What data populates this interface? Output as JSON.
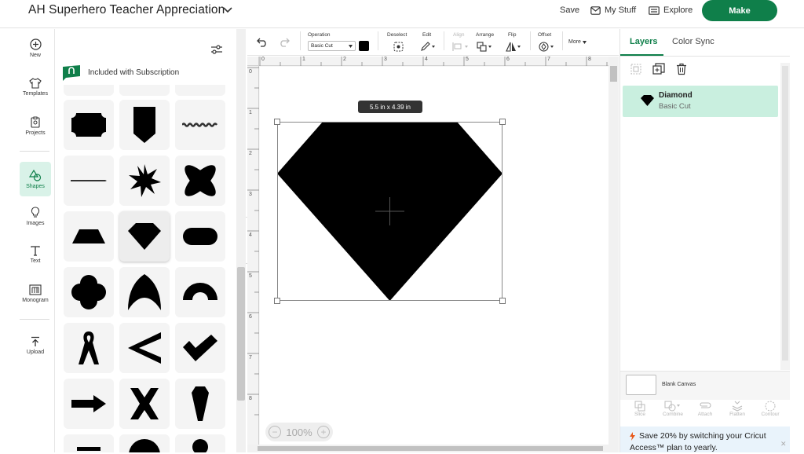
{
  "header": {
    "project_title": "AH Superhero Teacher Appreciation",
    "save_label": "Save",
    "my_stuff_label": "My Stuff",
    "explore_label": "Explore",
    "make_label": "Make"
  },
  "left_nav": {
    "items": [
      {
        "label": "New",
        "icon": "plus-circle-icon"
      },
      {
        "label": "Templates",
        "icon": "shirt-icon"
      },
      {
        "label": "Projects",
        "icon": "projects-icon"
      },
      {
        "label": "Shapes",
        "icon": "shapes-icon",
        "active": true
      },
      {
        "label": "Images",
        "icon": "lightbulb-icon"
      },
      {
        "label": "Text",
        "icon": "text-icon"
      },
      {
        "label": "Monogram",
        "icon": "monogram-icon"
      },
      {
        "label": "Upload",
        "icon": "upload-icon"
      }
    ]
  },
  "shapes_panel": {
    "subscription_label": "Included with Subscription",
    "shapes": [
      "label",
      "banner-pennant",
      "wavy-line",
      "line",
      "star-8",
      "four-petal",
      "trapezoid",
      "diamond",
      "rounded-rect",
      "quatrefoil",
      "arch",
      "half-circle",
      "ribbon",
      "chevron-left",
      "checkmark",
      "arrow-right",
      "x-mark",
      "gem-long"
    ]
  },
  "toolbar": {
    "operation_label": "Operation",
    "operation_value": "Basic Cut",
    "operation_color": "#000000",
    "deselect_label": "Deselect",
    "edit_label": "Edit",
    "align_label": "Align",
    "arrange_label": "Arrange",
    "flip_label": "Flip",
    "offset_label": "Offset",
    "more_label": "More"
  },
  "canvas": {
    "ruler_top": [
      "0",
      "1",
      "2",
      "3",
      "4",
      "5",
      "6",
      "7",
      "8"
    ],
    "ruler_left": [
      "0",
      "1",
      "2",
      "3",
      "4",
      "5",
      "6",
      "7",
      "8"
    ],
    "dimension_tooltip": "5.5  in x 4.39  in",
    "zoom_value": "100%",
    "shape_fill": "#000000"
  },
  "right_panel": {
    "tab_layers": "Layers",
    "tab_color_sync": "Color Sync",
    "layer": {
      "name": "Diamond",
      "operation": "Basic Cut"
    },
    "blank_canvas_label": "Blank Canvas",
    "bottom_tools": [
      "Slice",
      "Combine",
      "Attach",
      "Flatten",
      "Contour"
    ],
    "promo_line1": "Save 20% by switching your Cricut",
    "promo_line2": "Access™ plan to yearly."
  },
  "colors": {
    "brand": "#0f7f4a",
    "selected_layer": "#c9efdf",
    "active_nav": "#d9f2e8"
  }
}
